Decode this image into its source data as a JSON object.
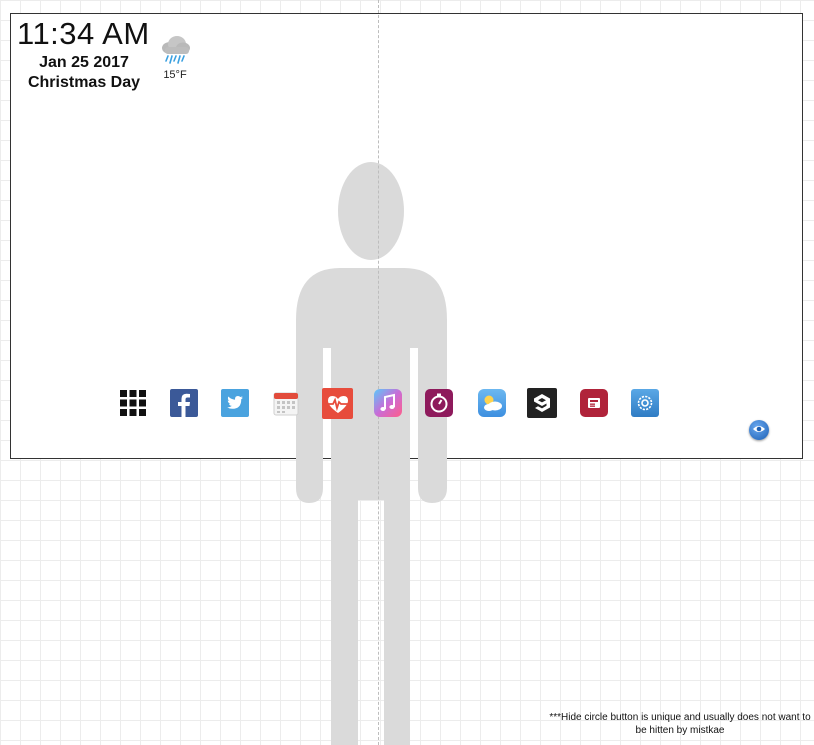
{
  "clock": {
    "time": "11:34 AM"
  },
  "date": {
    "date_text": "Jan 25 2017",
    "holiday": "Christmas Day"
  },
  "weather": {
    "icon": "rain-cloud-icon",
    "temperature": "15°F"
  },
  "dock": {
    "apps": [
      {
        "name": "app-grid",
        "icon": "grid-icon",
        "color": "#111111"
      },
      {
        "name": "facebook",
        "icon": "facebook-icon",
        "color": "#3b5998"
      },
      {
        "name": "twitter",
        "icon": "twitter-icon",
        "color": "#4aa3df"
      },
      {
        "name": "calendar",
        "icon": "calendar-icon",
        "color": "#e8e8e8"
      },
      {
        "name": "health",
        "icon": "heartbeat-icon",
        "color": "#e74c3c"
      },
      {
        "name": "music",
        "icon": "music-note-icon",
        "color": "#c86dd7"
      },
      {
        "name": "stopwatch",
        "icon": "stopwatch-icon",
        "color": "#8e1a5c"
      },
      {
        "name": "weather",
        "icon": "cloud-sun-icon",
        "color": "#5fa8e8"
      },
      {
        "name": "9gag",
        "icon": "9gag-icon",
        "color": "#222222"
      },
      {
        "name": "news",
        "icon": "news-icon",
        "color": "#b0233a"
      },
      {
        "name": "settings",
        "icon": "gear-icon",
        "color": "#3d8fd6"
      }
    ]
  },
  "hide_button": {
    "icon": "eye-icon"
  },
  "footnote": {
    "text": "***Hide circle button is unique and usually does not want to be hitten by mistkae"
  }
}
